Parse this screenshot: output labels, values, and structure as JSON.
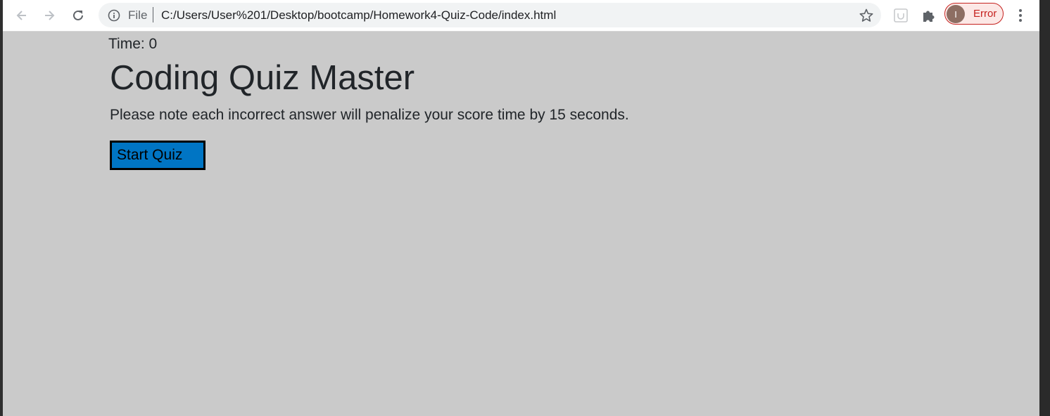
{
  "browser": {
    "scheme_label": "File",
    "url": "C:/Users/User%201/Desktop/bootcamp/Homework4-Quiz-Code/index.html",
    "profile": {
      "initial": "I",
      "status": "Error"
    },
    "icons": {
      "back": "back-arrow-icon",
      "forward": "forward-arrow-icon",
      "reload": "reload-icon",
      "info": "info-icon",
      "bookmark": "star-icon",
      "extension": "extension-icon",
      "puzzle": "puzzle-icon",
      "menu": "kebab-menu-icon"
    }
  },
  "page": {
    "timer": "Time: 0",
    "title": "Coding Quiz Master",
    "note": "Please note each incorrect answer will penalize your score time by 15 seconds.",
    "start_button": "Start Quiz"
  },
  "colors": {
    "page_background": "#cacaca",
    "button_background": "#0075c4",
    "error_accent": "#c5221f"
  }
}
